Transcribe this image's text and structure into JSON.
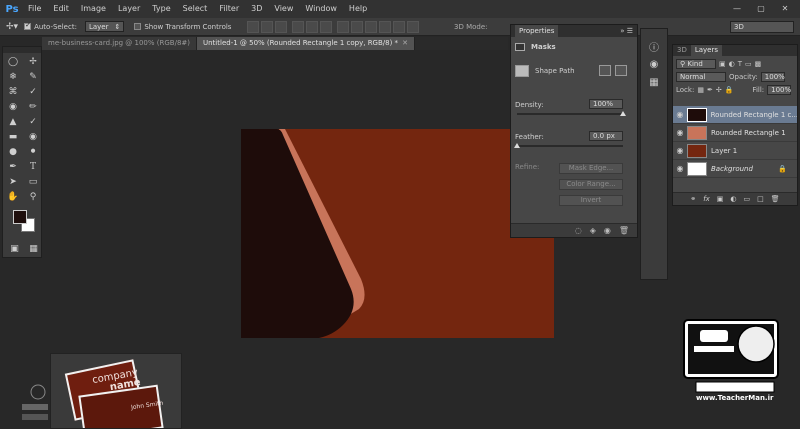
{
  "menubar": {
    "logo": "Ps",
    "items": [
      "File",
      "Edit",
      "Image",
      "Layer",
      "Type",
      "Select",
      "Filter",
      "3D",
      "View",
      "Window",
      "Help"
    ]
  },
  "options": {
    "auto_select_label": "Auto-Select:",
    "auto_select_value": "Layer",
    "show_transform_label": "Show Transform Controls",
    "mode_3d_label": "3D Mode:",
    "workspace": "3D"
  },
  "tabs": [
    {
      "label": "me-business-card.jpg @ 100% (RGB/8#)",
      "active": false
    },
    {
      "label": "Untitled-1 @ 50% (Rounded Rectangle 1 copy, RGB/8) *",
      "active": true
    }
  ],
  "properties": {
    "title": "Properties",
    "section": "Masks",
    "shape_path": "Shape Path",
    "density_label": "Density:",
    "density_value": "100%",
    "density_level": 1.0,
    "feather_label": "Feather:",
    "feather_value": "0.0 px",
    "feather_level": 0.0,
    "refine_label": "Refine:",
    "mask_edge": "Mask Edge...",
    "color_range": "Color Range...",
    "invert": "Invert"
  },
  "layers_panel": {
    "tab_3d": "3D",
    "tab_layers": "Layers",
    "kind": "Kind",
    "blend_mode": "Normal",
    "opacity_label": "Opacity:",
    "opacity_value": "100%",
    "lock_label": "Lock:",
    "fill_label": "Fill:",
    "fill_value": "100%",
    "layers": [
      {
        "name": "Rounded Rectangle 1 c...",
        "selected": true
      },
      {
        "name": "Rounded Rectangle 1",
        "selected": false
      },
      {
        "name": "Layer 1",
        "selected": false
      },
      {
        "name": "Background",
        "selected": false
      }
    ],
    "footer_icons": [
      "link-icon",
      "fx-icon",
      "mask-icon",
      "adjustment-icon",
      "folder-icon",
      "new-layer-icon",
      "trash-icon"
    ],
    "fx_label": "fx"
  },
  "colors": {
    "canvas_bg": "#74260f",
    "dark_card": "#1e0c0a",
    "highlight": "#c8745a",
    "selected_layer": "#6a7b92"
  },
  "thumbnail": {
    "company": "company",
    "name": "name",
    "person": "John Smith"
  },
  "branding": {
    "url": "www.TeacherMan.ir"
  }
}
